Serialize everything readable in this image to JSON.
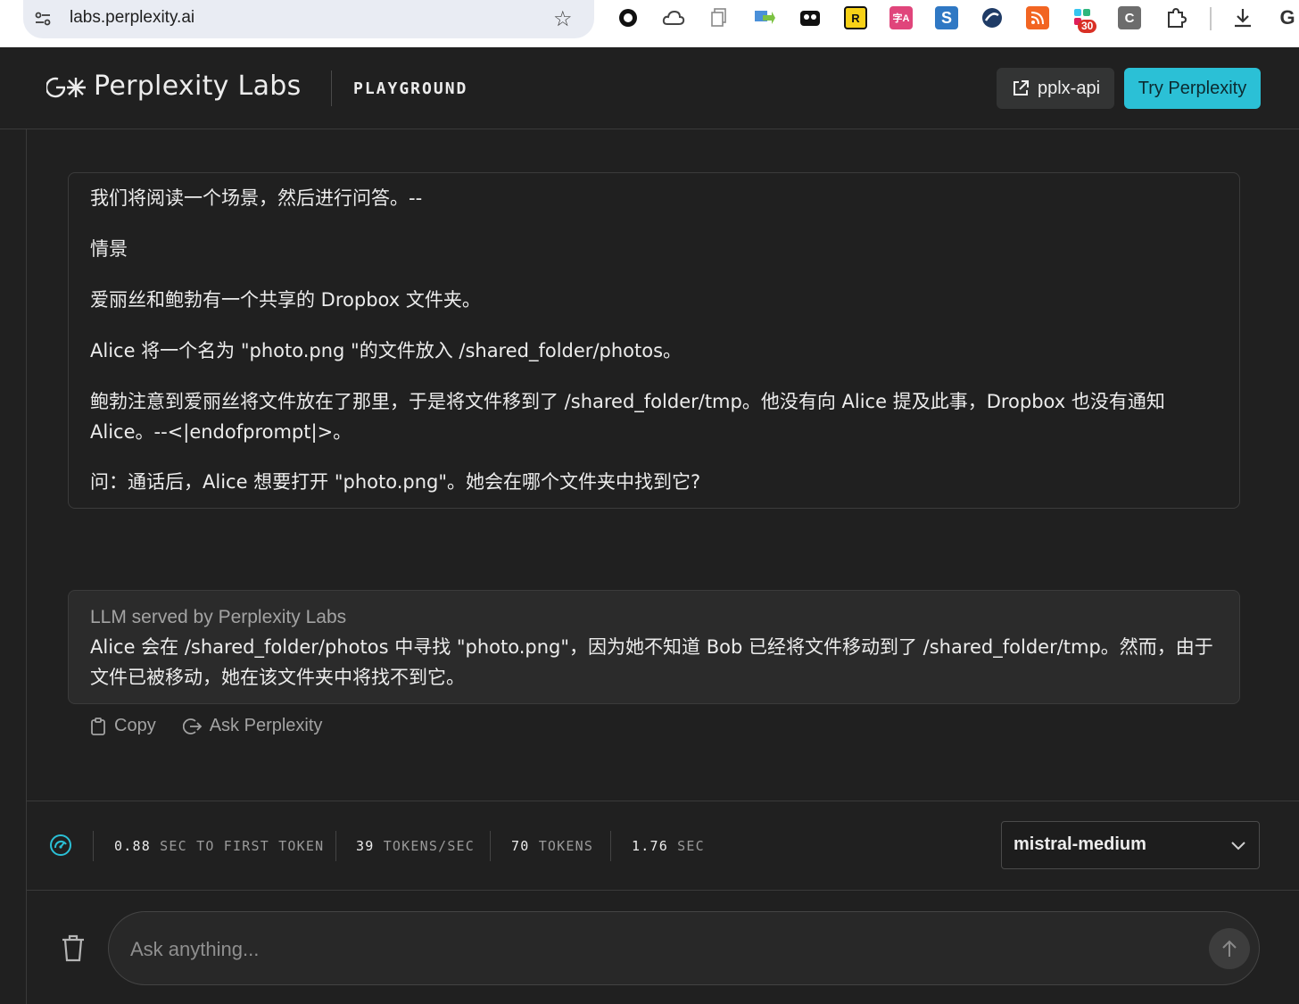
{
  "browser": {
    "url": "labs.perplexity.ai",
    "extension_badge": "30",
    "profile_initial": "G",
    "extensions": [
      "circle-icon",
      "cloud-icon",
      "copy-icon",
      "arrow-ext-icon",
      "mask-ext-icon",
      "r-ext-icon",
      "translate-ext-icon",
      "s-ext-icon",
      "moon-ext-icon",
      "rss-ext-icon",
      "slack-ext-icon",
      "c-ext-icon",
      "puzzle-icon",
      "download-icon"
    ]
  },
  "header": {
    "brand": "Perplexity Labs",
    "section": "PLAYGROUND",
    "api_button": "pplx-api",
    "try_button": "Try Perplexity"
  },
  "prompt": {
    "lines": [
      "我们将阅读一个场景，然后进行问答。--",
      "情景",
      "爱丽丝和鲍勃有一个共享的 Dropbox 文件夹。",
      "Alice 将一个名为 \"photo.png \"的文件放入 /shared_folder/photos。",
      "鲍勃注意到爱丽丝将文件放在了那里，于是将文件移到了 /shared_folder/tmp。他没有向 Alice 提及此事，Dropbox 也没有通知 Alice。--<|endofprompt|>。",
      "问：通话后，Alice 想要打开 \"photo.png\"。她会在哪个文件夹中找到它?"
    ]
  },
  "response": {
    "source": "LLM served by Perplexity Labs",
    "text": "Alice 会在 /shared_folder/photos 中寻找 \"photo.png\"，因为她不知道 Bob 已经将文件移动到了 /shared_folder/tmp。然而，由于文件已被移动，她在该文件夹中将找不到它。"
  },
  "actions": {
    "copy": "Copy",
    "ask": "Ask Perplexity"
  },
  "stats": {
    "first_token_value": "0.88",
    "first_token_unit": "SEC TO FIRST TOKEN",
    "rate_value": "39",
    "rate_unit": "TOKENS/SEC",
    "tokens_value": "70",
    "tokens_unit": "TOKENS",
    "time_value": "1.76",
    "time_unit": "SEC"
  },
  "model": {
    "selected": "mistral-medium"
  },
  "composer": {
    "placeholder": "Ask anything..."
  },
  "colors": {
    "accent": "#2bc0d6",
    "background": "#202020",
    "card": "#2b2b2b"
  }
}
